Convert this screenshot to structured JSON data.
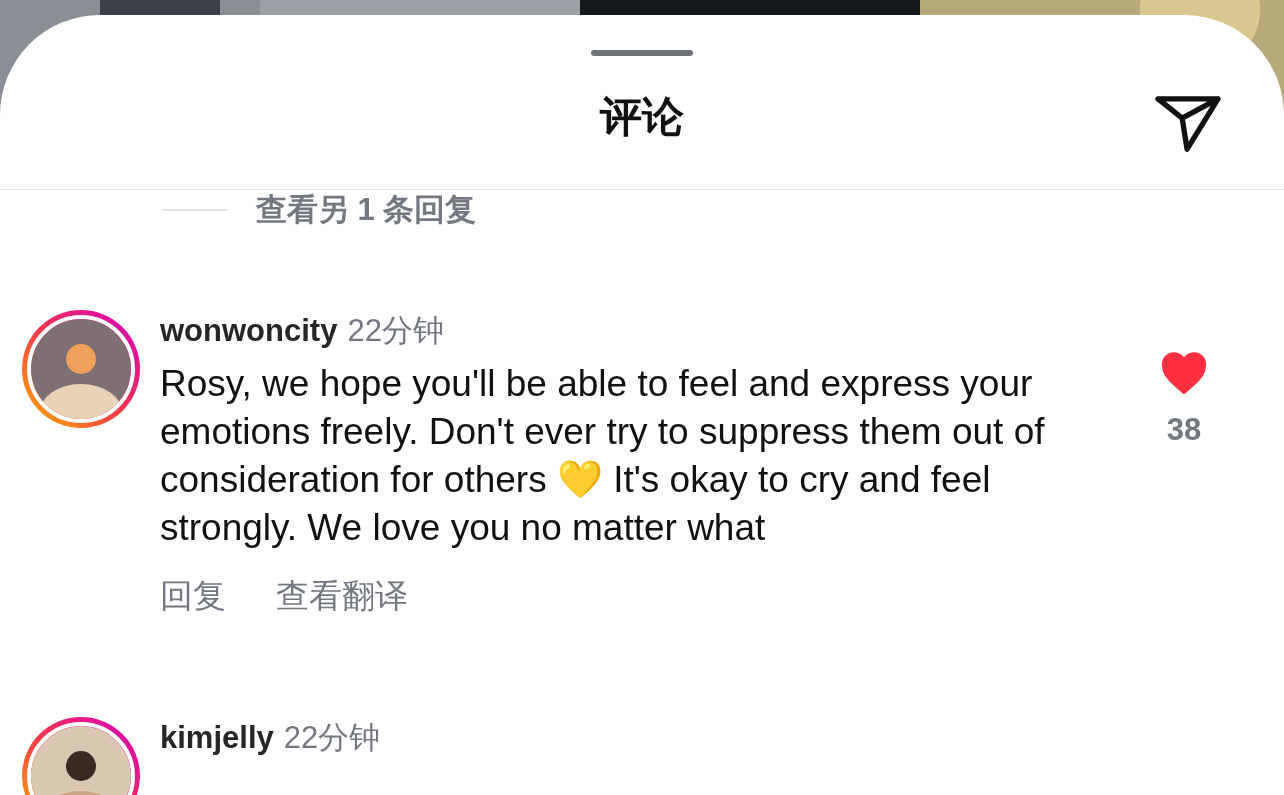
{
  "sheet": {
    "title": "评论"
  },
  "more_replies": {
    "label": "查看另 1 条回复"
  },
  "comments": [
    {
      "username": "wonwoncity",
      "time": "22分钟",
      "text": "Rosy, we hope you'll be able to feel and express your emotions freely. Don't ever try to suppress them out of consideration for others 💛 It's okay to cry and feel strongly. We love you no matter what",
      "liked": true,
      "like_count": "38",
      "actions": [
        "回复",
        "查看翻译"
      ]
    },
    {
      "username": "kimjelly",
      "time": "22分钟"
    }
  ]
}
